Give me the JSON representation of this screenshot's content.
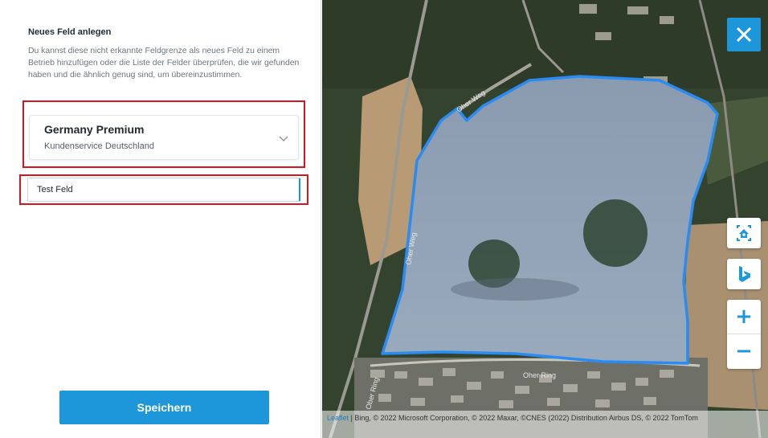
{
  "panel": {
    "title": "Neues Feld anlegen",
    "description": "Du kannst diese nicht erkannte Feldgrenze als neues Feld zu einem Betrieb hinzufügen oder die Liste der Felder überprüfen, die wir gefunden haben und die ähnlich genug sind, um übereinzustimmen.",
    "select": {
      "selected_title": "Germany Premium",
      "selected_subtitle": "Kundenservice Deutschland",
      "icon": "chevron-down-icon"
    },
    "field_name_input": {
      "value": "Test Feld",
      "placeholder": ""
    },
    "save_label": "Speichern"
  },
  "map": {
    "road_labels": [
      "Oher Weg",
      "Oher Weg",
      "Oher Ring",
      "Ober Ring"
    ],
    "controls": {
      "close_icon": "close-icon",
      "home_icon": "locate-home-icon",
      "bing_icon": "bing-logo-icon",
      "zoom_in": "+",
      "zoom_out": "−"
    },
    "attribution": {
      "link": "Leaflet",
      "text": " | Bing, © 2022 Microsoft Corporation, © 2022 Maxar, ©CNES (2022) Distribution Airbus DS, © 2022 TomTom"
    }
  },
  "colors": {
    "accent": "#1d97da",
    "highlight": "#d8141c",
    "field_boundary": "#2a8cf0"
  }
}
